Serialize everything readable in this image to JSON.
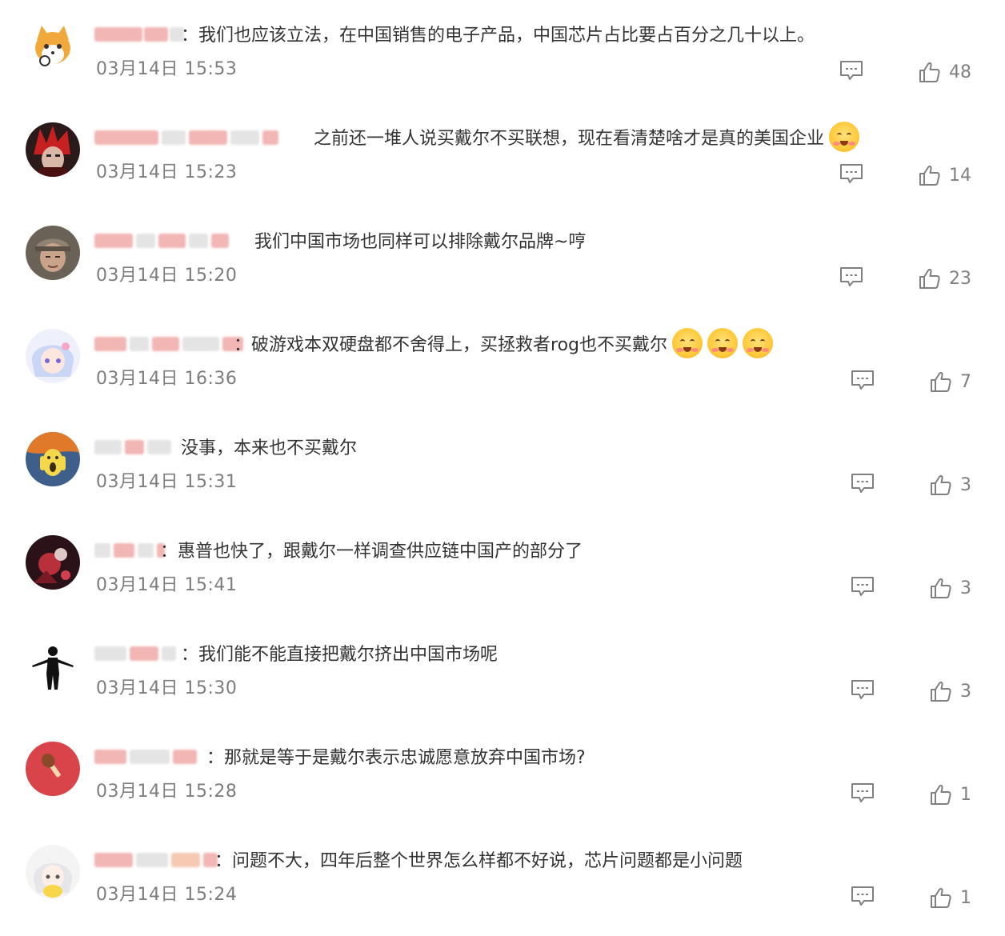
{
  "comments": [
    {
      "text": "：我们也应该立法，在中国销售的电子产品，中国芯片占比要占百分之几十以上。",
      "time": "03月14日 15:53",
      "likes": "48",
      "avatar": "shiba-avatar"
    },
    {
      "text": "之前还一堆人说买戴尔不买联想，现在看清楚啥才是真的美国企业",
      "time": "03月14日 15:23",
      "likes": "14",
      "avatar": "red-hair-avatar",
      "emoji_count": 1
    },
    {
      "text": "我们中国市场也同样可以排除戴尔品牌~哼",
      "time": "03月14日 15:20",
      "likes": "23",
      "avatar": "man-cap-avatar"
    },
    {
      "text": "：破游戏本双硬盘都不舍得上，买拯救者rog也不买戴尔",
      "time": "03月14日 16:36",
      "likes": "7",
      "avatar": "anime-girl-avatar",
      "emoji_count": 3
    },
    {
      "text": "没事，本来也不买戴尔",
      "time": "03月14日 15:31",
      "likes": "3",
      "avatar": "scream-avatar"
    },
    {
      "text": "：惠普也快了，跟戴尔一样调查供应链中国产的部分了",
      "time": "03月14日 15:41",
      "likes": "3",
      "avatar": "dark-red-avatar"
    },
    {
      "text": "：我们能不能直接把戴尔挤出中国市场呢",
      "time": "03月14日 15:30",
      "likes": "3",
      "avatar": "silhouette-avatar"
    },
    {
      "text": "：那就是等于是戴尔表示忠诚愿意放弃中国市场?",
      "time": "03月14日 15:28",
      "likes": "1",
      "avatar": "red-circle-avatar"
    },
    {
      "text": "：问题不大，四年后整个世界怎么样都不好说，芯片问题都是小问题",
      "time": "03月14日 15:24",
      "likes": "1",
      "avatar": "chick-girl-avatar"
    }
  ]
}
